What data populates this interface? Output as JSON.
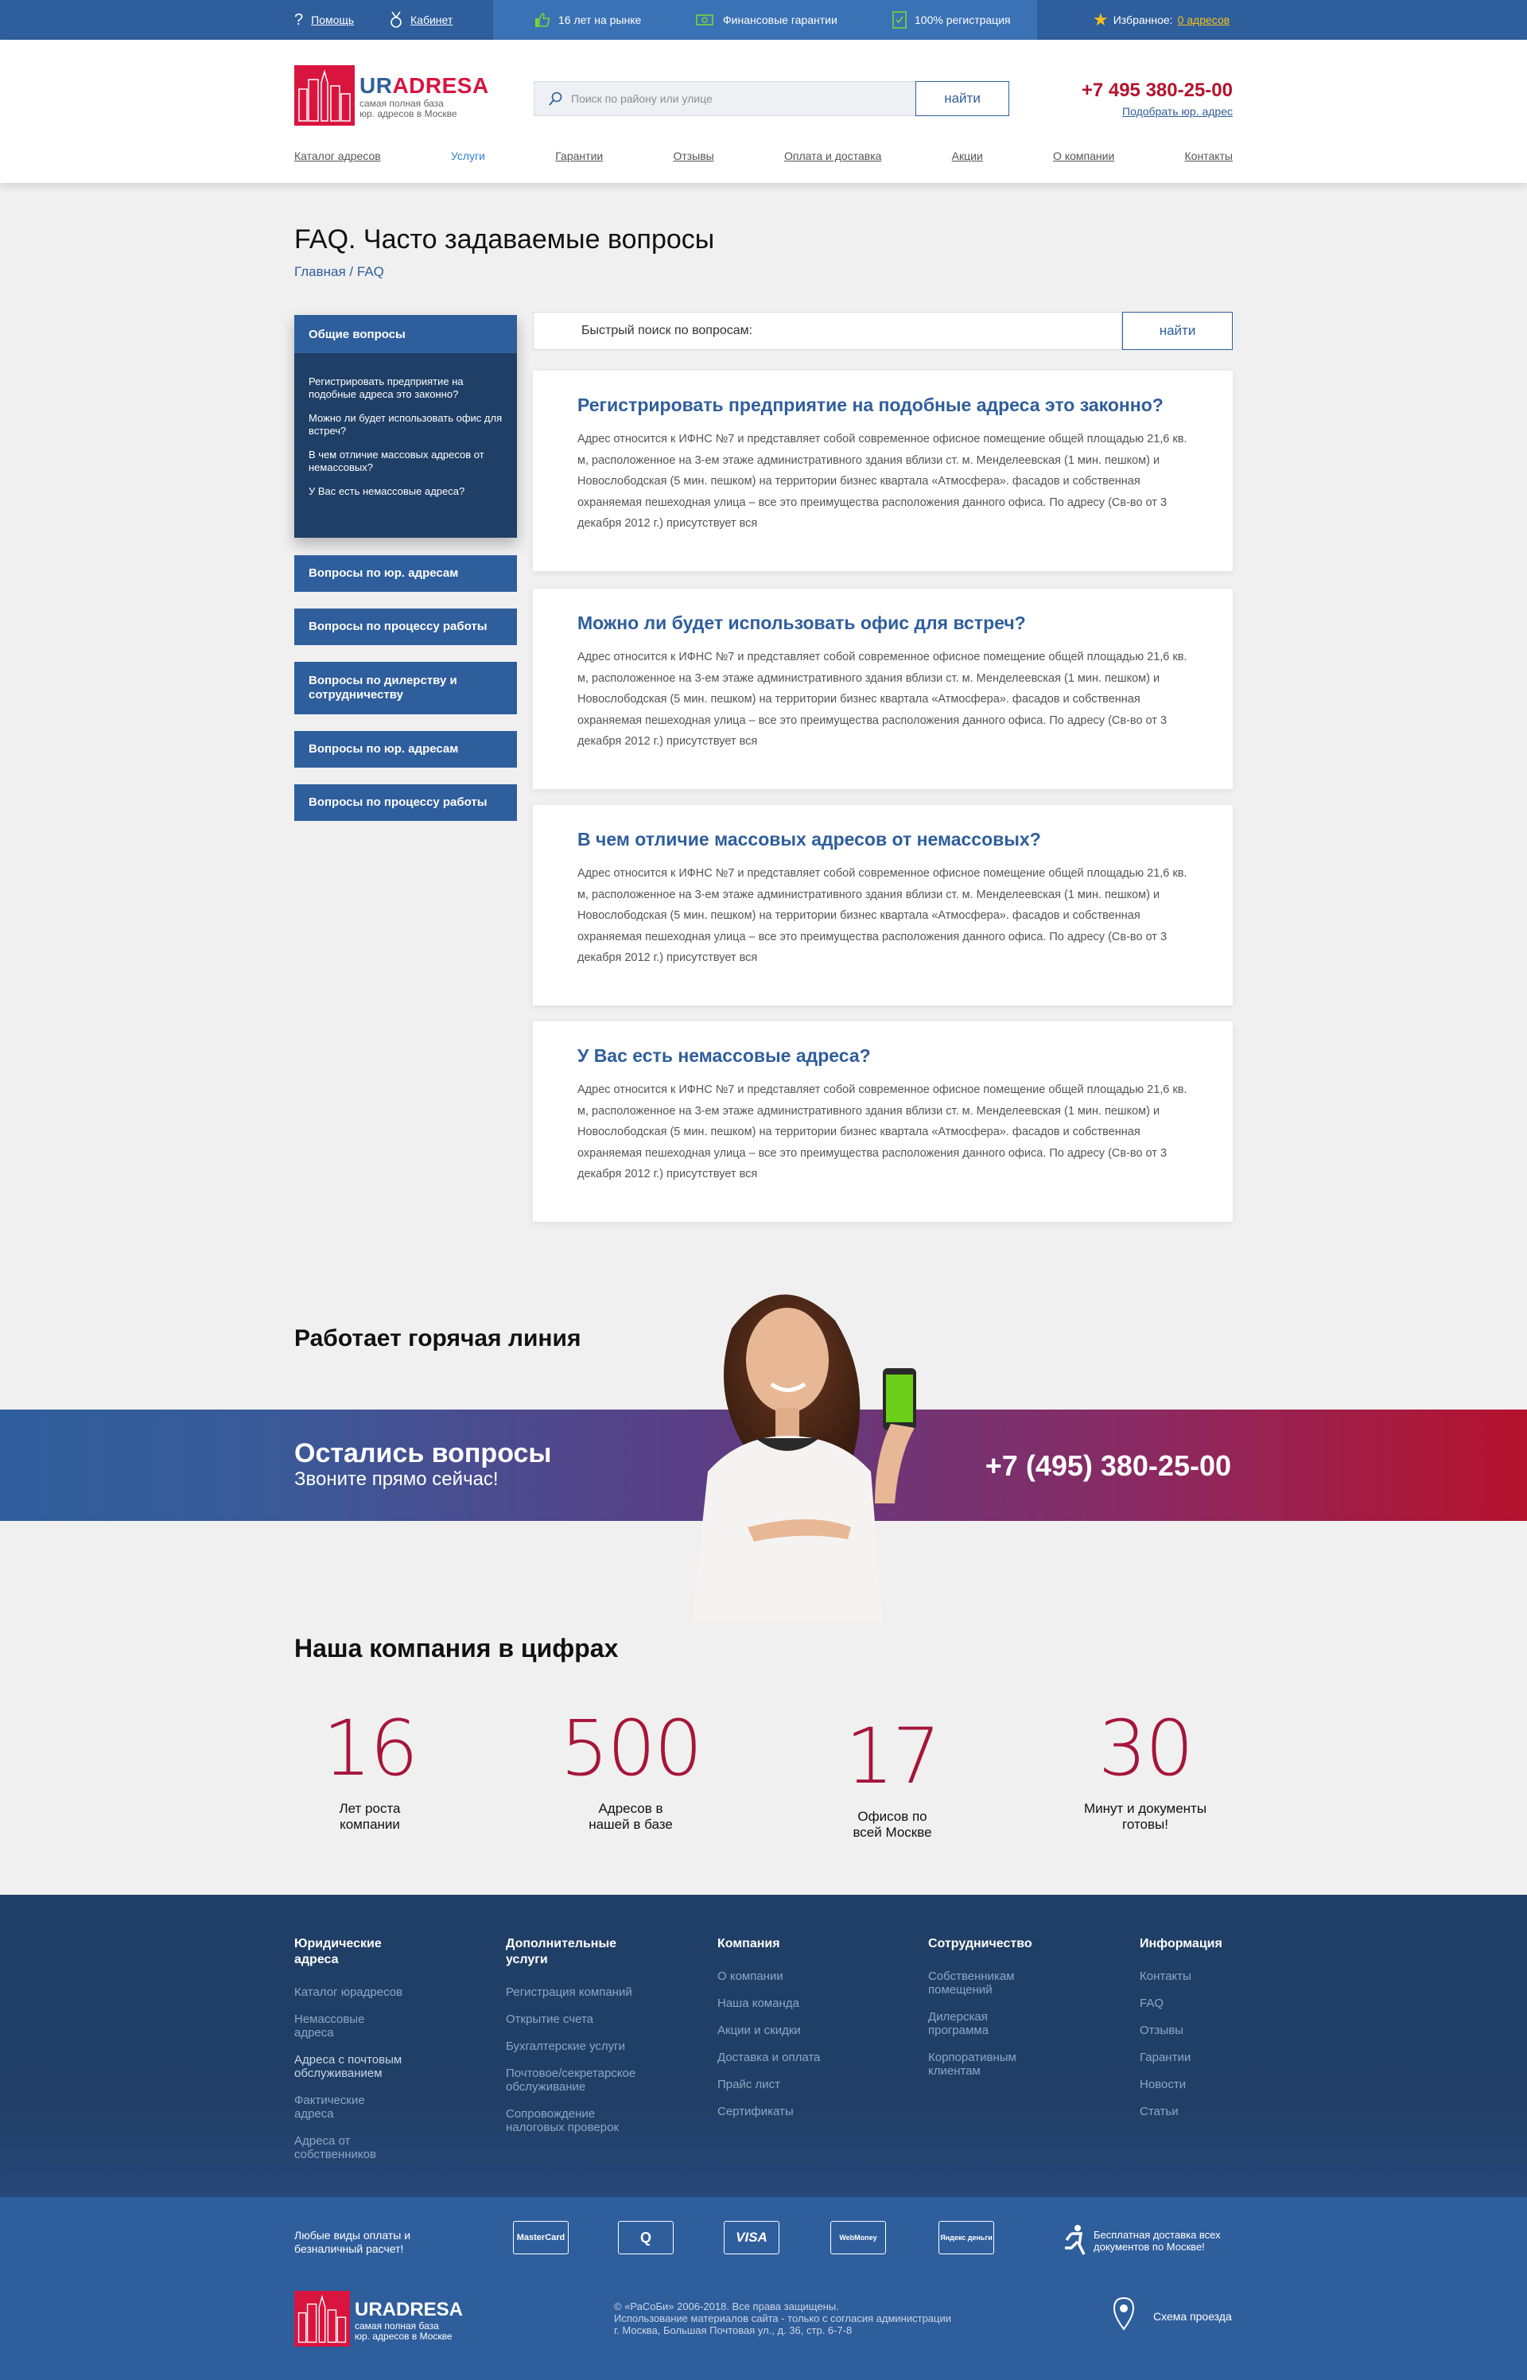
{
  "topbar": {
    "help": "Помощь",
    "cabinet": "Кабинет",
    "years": "16 лет на рынке",
    "guarantees": "Финансовые гарантии",
    "registration": "100% регистрация",
    "favorites_label": "Избранное:",
    "favorites_count": "0 адресов"
  },
  "header": {
    "logo_ur": "UR",
    "logo_adresa": "ADRESA",
    "logo_sub1": "самая полная база",
    "logo_sub2": "юр. адресов в Москве",
    "search_placeholder": "Поиск по району или улице",
    "search_button": "найти",
    "phone": "+7 495 380-25-00",
    "phone_link": "Подобрать юр. адрес"
  },
  "nav": [
    "Каталог адресов",
    "Услуги",
    "Гарантии",
    "Отзывы",
    "Оплата и доставка",
    "Акции",
    "О компании",
    "Контакты"
  ],
  "page": {
    "title": "FAQ. Часто задаваемые вопросы",
    "breadcrumb": "Главная / FAQ"
  },
  "sidebar": {
    "open_title": "Общие вопросы",
    "open_items": [
      "Регистрировать предприятие на подобные адреса это законно?",
      "Можно ли будет использовать офис для встреч?",
      "В чем отличие массовых адресов от немассовых?",
      "У Вас есть немассовые адреса?"
    ],
    "buttons": [
      "Вопросы по юр. адресам",
      "Вопросы по процессу работы",
      "Вопросы по дилерству и сотрудничеству",
      "Вопросы по юр. адресам",
      "Вопросы по процессу работы"
    ]
  },
  "quick_search": {
    "label": "Быстрый поиск по вопросам:",
    "button": "найти"
  },
  "faq": [
    {
      "q": "Регистрировать предприятие на подобные адреса это законно?",
      "a": "Адрес относится к ИФНС №7 и представляет собой современное офисное помещение общей площадью 21,6 кв. м, расположенное на 3-ем этаже административного здания вблизи ст. м. Менделеевская (1 мин. пешком) и Новослободская (5 мин. пешком) на территории бизнес квартала «Атмосфера». фасадов и собственная охраняемая пешеходная улица – все это преимущества расположения данного офиса. По адресу (Св-во от 3 декабря 2012 г.) присутствует вся"
    },
    {
      "q": "Можно ли будет использовать офис для встреч?",
      "a": "Адрес относится к ИФНС №7 и представляет собой современное офисное помещение общей площадью 21,6 кв. м, расположенное на 3-ем этаже административного здания вблизи ст. м. Менделеевская (1 мин. пешком) и Новослободская (5 мин. пешком) на территории бизнес квартала «Атмосфера». фасадов и собственная охраняемая пешеходная улица – все это преимущества расположения данного офиса. По адресу (Св-во от 3 декабря 2012 г.) присутствует вся"
    },
    {
      "q": "В чем отличие массовых адресов от немассовых?",
      "a": "Адрес относится к ИФНС №7 и представляет собой современное офисное помещение общей площадью 21,6 кв. м, расположенное на 3-ем этаже административного здания вблизи ст. м. Менделеевская (1 мин. пешком) и Новослободская (5 мин. пешком) на территории бизнес квартала «Атмосфера». фасадов и собственная охраняемая пешеходная улица – все это преимущества расположения данного офиса. По адресу (Св-во от 3 декабря 2012 г.) присутствует вся"
    },
    {
      "q": "У Вас есть немассовые адреса?",
      "a": "Адрес относится к ИФНС №7 и представляет собой современное офисное помещение общей площадью 21,6 кв. м, расположенное на 3-ем этаже административного здания вблизи ст. м. Менделеевская (1 мин. пешком) и Новослободская (5 мин. пешком) на территории бизнес квартала «Атмосфера». фасадов и собственная охраняемая пешеходная улица – все это преимущества расположения данного офиса. По адресу (Св-во от 3 декабря 2012 г.) присутствует вся"
    }
  ],
  "hotline": {
    "title": "Работает горячая линия",
    "band_title": "Остались вопросы",
    "band_sub": "Звоните прямо сейчас!",
    "phone": "+7 (495) 380-25-00"
  },
  "stats": {
    "title": "Наша компания в цифрах",
    "items": [
      {
        "num": "16",
        "label": "Лет роста компании"
      },
      {
        "num": "500",
        "label": "Адресов в нашей в базе"
      },
      {
        "num": "17",
        "label": "Офисов по всей Москве"
      },
      {
        "num": "30",
        "label": "Минут и документы готовы!"
      }
    ]
  },
  "footer": {
    "cols": [
      {
        "title": "Юридические адреса",
        "items": [
          "Каталог юрадресов",
          "Немассовые адреса",
          "Адреса с почтовым обслуживанием",
          "Фактические адреса",
          "Адреса от собственников"
        ]
      },
      {
        "title": "Дополнительные услуги",
        "items": [
          "Регистрация компаний",
          "Открытие счета",
          "Бухгалтерские услуги",
          "Почтовое/секретарское обслуживание",
          "Сопровождение налоговых проверок"
        ]
      },
      {
        "title": "Компания",
        "items": [
          "О компании",
          "Наша команда",
          "Акции и скидки",
          "Доставка и оплата",
          "Прайс лист",
          "Сертификаты"
        ]
      },
      {
        "title": "Сотрудничество",
        "items": [
          "Собственникам помещений",
          "Дилерская программа",
          "Корпоративным клиентам"
        ]
      },
      {
        "title": "Информация",
        "items": [
          "Контакты",
          "FAQ",
          "Отзывы",
          "Гарантии",
          "Новости",
          "Статьи"
        ]
      }
    ],
    "pay_text": "Любые виды оплаты и безналичный расчет!",
    "pay_methods": [
      "MasterCard",
      "Q",
      "VISA",
      "WebMoney",
      "Яндекс деньги"
    ],
    "delivery": "Бесплатная доставка всех документов по Москве!",
    "logo": "URADRESA",
    "logo_sub1": "самая полная база",
    "logo_sub2": "юр. адресов в Москве",
    "copyright1": "© «РаСоБи» 2006-2018. Все права защищены.",
    "copyright2": "Использование материалов сайта - только с согласия администрации",
    "copyright3": "г. Москва, Большая Почтовая ул., д. 36, стр. 6-7-8",
    "scheme": "Схема проезда"
  },
  "colors": {
    "brand_blue": "#2f5e9c",
    "brand_red": "#b5122d",
    "navy": "#1f3f66",
    "accent_yellow": "#f4c01f"
  }
}
